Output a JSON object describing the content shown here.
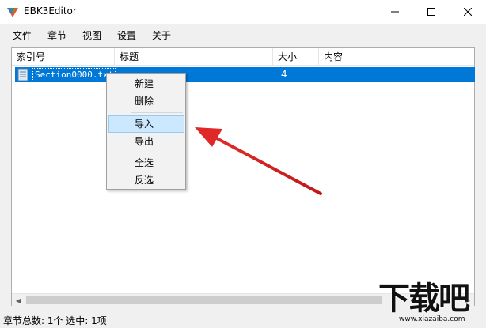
{
  "window": {
    "title": "EBK3Editor",
    "min_icon": "minimize-icon",
    "max_icon": "maximize-icon",
    "close_icon": "close-icon"
  },
  "menubar": {
    "items": [
      "文件",
      "章节",
      "视图",
      "设置",
      "关于"
    ]
  },
  "listview": {
    "columns": [
      "索引号",
      "标题",
      "大小",
      "内容"
    ],
    "rows": [
      {
        "index": "Section0000.txt",
        "title": "",
        "size": "4",
        "content": "",
        "selected": true
      }
    ]
  },
  "context_menu": {
    "items": [
      "新建",
      "删除",
      "导入",
      "导出",
      "全选",
      "反选"
    ],
    "highlighted": "导入"
  },
  "statusbar": {
    "text": "章节总数: 1个  选中: 1项"
  },
  "watermark": {
    "text": "下载吧",
    "url": "www.xiazaiba.com"
  },
  "colors": {
    "selection": "#0078d7",
    "menu_highlight": "#cce8ff",
    "annotation_arrow": "#e02020"
  }
}
